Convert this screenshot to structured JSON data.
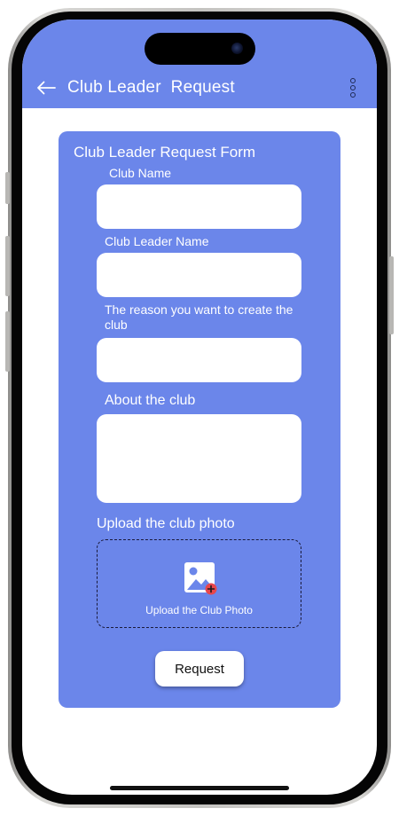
{
  "appbar": {
    "title": "Club Leader  Request",
    "back_icon": "arrow-left-icon",
    "menu_icon": "more-vertical-icon",
    "background": "#6b86ea"
  },
  "form": {
    "title": "Club Leader Request Form",
    "background": "#6b86ea",
    "club_name_label": "Club Name",
    "club_name_value": "",
    "leader_name_label": "Club Leader Name",
    "leader_name_value": "",
    "reason_label": "The reason you want to create the club",
    "reason_value": "",
    "about_label": "About the club",
    "about_value": "",
    "upload_label": "Upload the club photo",
    "upload_box_text": "Upload the Club Photo",
    "upload_icon": "add-image-icon",
    "submit_label": "Request"
  }
}
